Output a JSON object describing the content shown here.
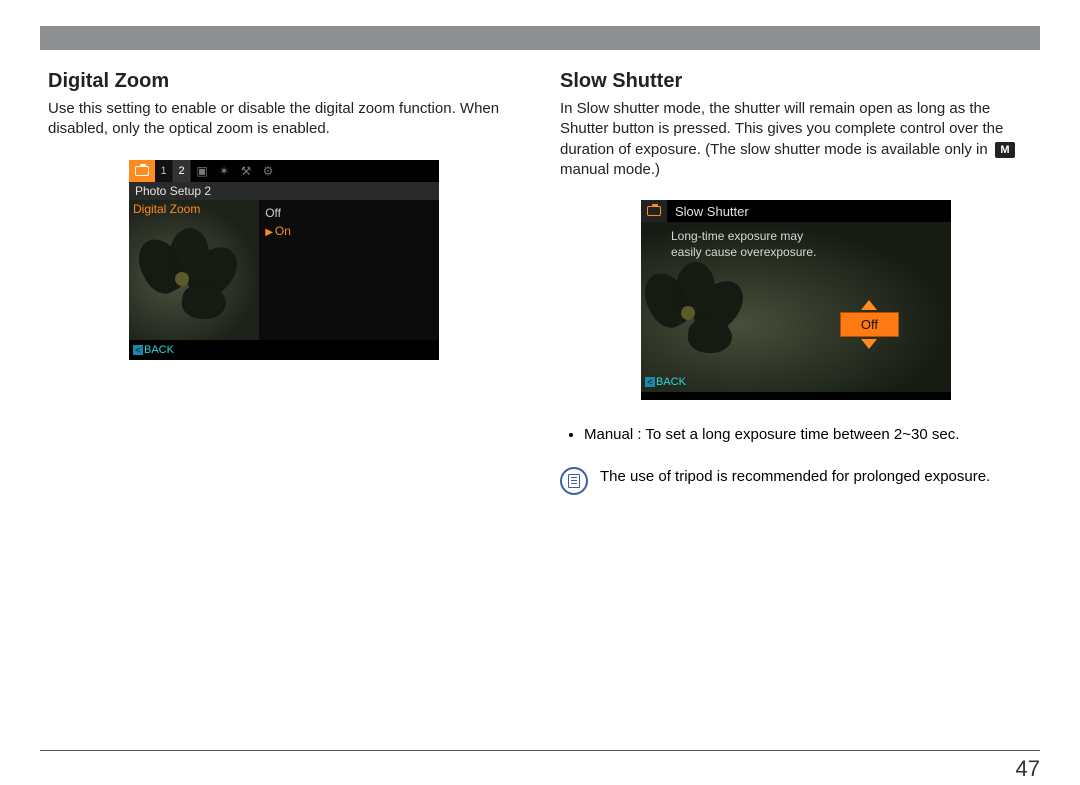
{
  "page_number": "47",
  "left": {
    "heading": "Digital Zoom",
    "desc": "Use this setting to enable or disable the digital zoom function. When disabled, only the optical zoom is enabled.",
    "lcd": {
      "tabs": [
        "1",
        "2"
      ],
      "title": "Photo Setup 2",
      "setting_label": "Digital Zoom",
      "options": {
        "off": "Off",
        "on": "On"
      },
      "back": "BACK"
    }
  },
  "right": {
    "heading": "Slow Shutter",
    "desc_pre": "In Slow shutter mode, the shutter will remain open as long as the Shutter button is pressed. This gives you complete control over the duration of exposure. (The slow shutter mode is available only in ",
    "desc_badge": "M",
    "desc_post": " manual mode.)",
    "lcd": {
      "title": "Slow Shutter",
      "warn1": "Long-time exposure may",
      "warn2": "easily cause overexposure.",
      "value": "Off",
      "back": "BACK"
    },
    "bullet": "Manual : To set a long exposure time between 2~30 sec.",
    "note": "The use of tripod is recommended for prolonged exposure."
  }
}
